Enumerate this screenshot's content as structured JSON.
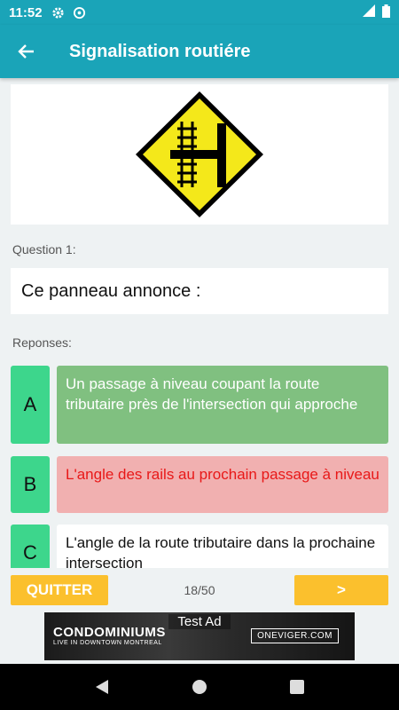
{
  "status_bar": {
    "time": "11:52"
  },
  "app_bar": {
    "title": "Signalisation routiére"
  },
  "question": {
    "label": "Question 1:",
    "text": "Ce panneau annonce :"
  },
  "answers_label": "Reponses:",
  "answers": [
    {
      "letter": "A",
      "text": "Un  passage à  niveau coupant la route tributaire près de l'intersection qui approche",
      "state": "correct"
    },
    {
      "letter": "B",
      "text": "L'angle des rails au prochain passage à niveau",
      "state": "wrong"
    },
    {
      "letter": "C",
      "text": "L'angle de la route tributaire dans la prochaine intersection",
      "state": "neutral"
    }
  ],
  "footer": {
    "quit_label": "QUITTER",
    "counter": "18/50",
    "next_label": ">"
  },
  "ad": {
    "tag": "Test Ad",
    "brand": "CONDOMINIUMS",
    "subtitle": "LIVE IN DOWNTOWN MONTREAL",
    "cta": "ONEVIGER.COM"
  },
  "colors": {
    "primary": "#1aa4b8",
    "letter_bg": "#3dd68c",
    "correct_bg": "#80c080",
    "wrong_bg": "#f1b0b0",
    "wrong_text": "#e81818",
    "accent": "#fbc02d"
  }
}
